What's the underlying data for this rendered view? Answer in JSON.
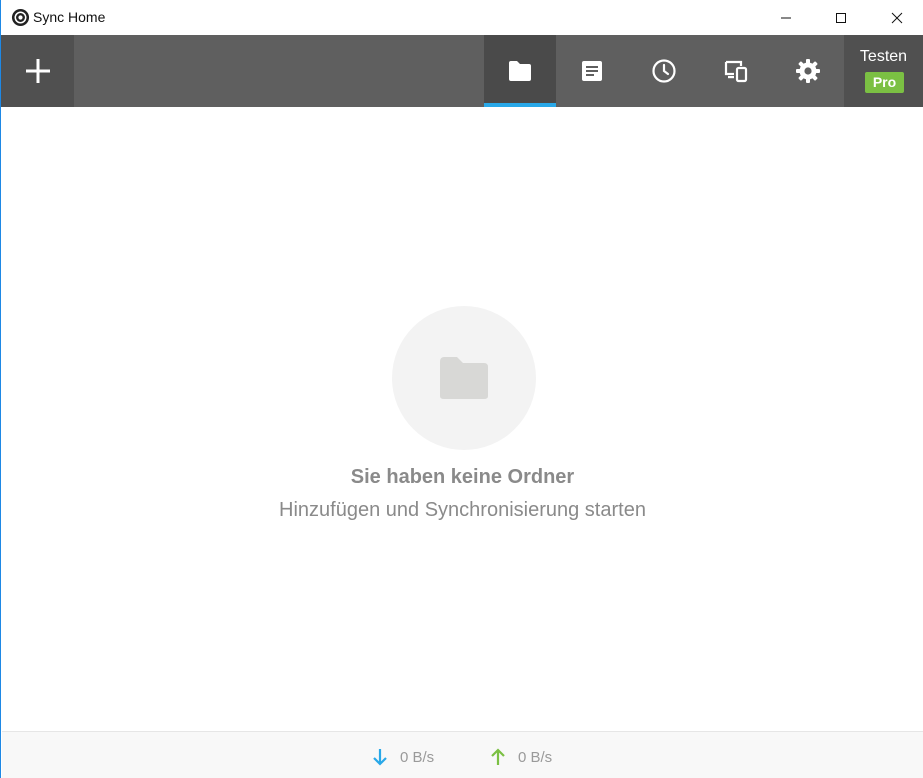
{
  "window": {
    "title": "Sync Home"
  },
  "toolbar": {
    "add_icon": "plus-icon",
    "nav": [
      {
        "id": "folders",
        "icon": "folder-icon",
        "active": true
      },
      {
        "id": "log",
        "icon": "document-icon",
        "active": false
      },
      {
        "id": "history",
        "icon": "clock-icon",
        "active": false
      },
      {
        "id": "devices",
        "icon": "devices-icon",
        "active": false
      },
      {
        "id": "settings",
        "icon": "gear-icon",
        "active": false
      }
    ],
    "account": {
      "name": "Testen",
      "badge": "Pro"
    }
  },
  "empty_state": {
    "icon": "folder-icon",
    "title": "Sie haben keine Ordner",
    "subtitle": "Hinzufügen und Synchronisierung starten"
  },
  "statusbar": {
    "download_rate": "0 B/s",
    "upload_rate": "0 B/s"
  },
  "colors": {
    "toolbar": "#5f5f5f",
    "active_indicator": "#29a8e8",
    "pro_badge": "#7bc043",
    "download_arrow": "#29a8e8",
    "upload_arrow": "#7bc043"
  }
}
